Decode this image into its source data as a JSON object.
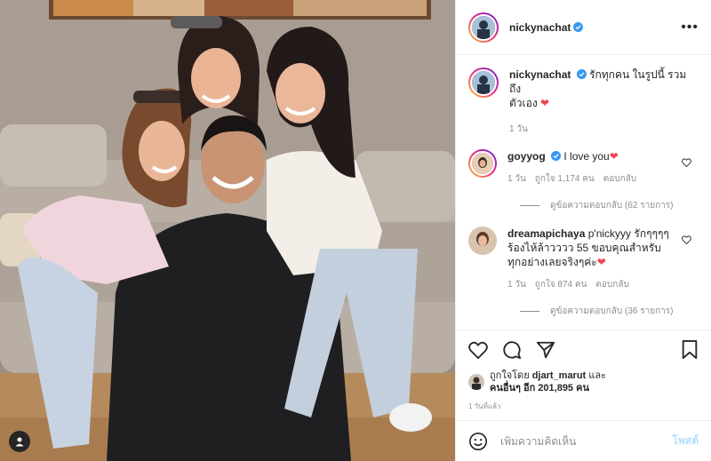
{
  "post": {
    "author": "nickynachat",
    "more_label": "•••",
    "caption_line1": "รักทุกคน ในรูปนี้ รวมถึง",
    "caption_line2": "ตัวเอง",
    "caption_heart": "❤",
    "caption_time": "1 วัน"
  },
  "comments": [
    {
      "user": "goyyog",
      "verified": true,
      "text": "I love you",
      "heart": "❤",
      "time": "1 วัน",
      "likes": "ถูกใจ 1,174 คน",
      "reply_label": "ตอบกลับ",
      "view_replies": "ดูข้อความตอบกลับ (62 รายการ)"
    },
    {
      "user": "dreamapichaya",
      "verified": false,
      "text_line1": "p'nickyyy รักๆๆๆๆ",
      "text_line2": "ร้องไห้ล้าวววว 55 ขอบคุณสำหรับ",
      "text_line3": "ทุกอย่างเลยจริงๆค่ะ",
      "heart": "❤",
      "time": "1 วัน",
      "likes": "ถูกใจ 874 คน",
      "reply_label": "ตอบกลับ",
      "view_replies": "ดูข้อความตอบกลับ (36 รายการ)"
    }
  ],
  "liked_by": {
    "prefix": "ถูกใจโดย",
    "user": "djart_marut",
    "and": "และ",
    "others": "คนอื่นๆ อีก 201,895 คน"
  },
  "timestamp": "1 วันที่แล้ว",
  "add_comment": {
    "placeholder": "เพิ่มความคิดเห็น",
    "post_label": "โพสต์"
  },
  "icons": {
    "photo_tag": "user-tag-icon",
    "like": "heart-icon",
    "comment": "comment-icon",
    "share": "share-icon",
    "save": "bookmark-icon",
    "emoji": "emoji-icon",
    "verified": "verified-badge-icon"
  },
  "colors": {
    "verified": "#3897f0",
    "heart": "#ed4956",
    "post_button_disabled": "#b2dffc",
    "muted_text": "#8e8e8e"
  }
}
